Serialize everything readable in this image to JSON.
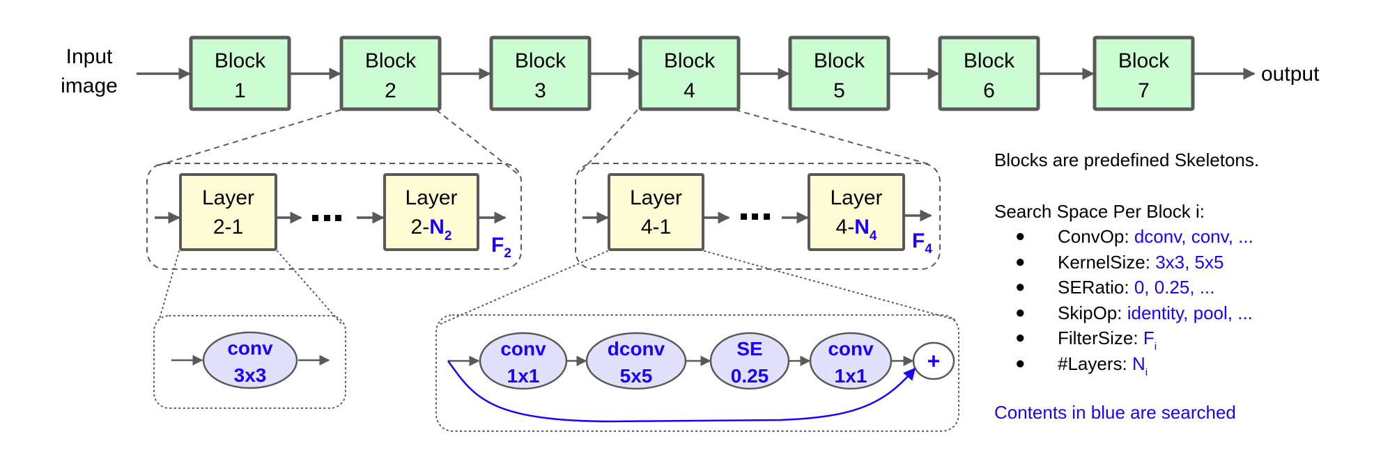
{
  "input_label": [
    "Input",
    "image"
  ],
  "output_label": "output",
  "blocks": [
    {
      "title": "Block",
      "number": "1"
    },
    {
      "title": "Block",
      "number": "2"
    },
    {
      "title": "Block",
      "number": "3"
    },
    {
      "title": "Block",
      "number": "4"
    },
    {
      "title": "Block",
      "number": "5"
    },
    {
      "title": "Block",
      "number": "6"
    },
    {
      "title": "Block",
      "number": "7"
    }
  ],
  "expansions": [
    {
      "block": "2",
      "first_layer": {
        "title": "Layer",
        "id": "2-1"
      },
      "last_layer": {
        "title": "Layer",
        "prefix": "2-",
        "var": "N",
        "sub": "2"
      },
      "ellipsis": "•••",
      "filter": {
        "var": "F",
        "sub": "2"
      }
    },
    {
      "block": "4",
      "first_layer": {
        "title": "Layer",
        "id": "4-1"
      },
      "last_layer": {
        "title": "Layer",
        "prefix": "4-",
        "var": "N",
        "sub": "4"
      },
      "ellipsis": "•••",
      "filter": {
        "var": "F",
        "sub": "4"
      }
    }
  ],
  "layer_2_ops": [
    {
      "op": "conv",
      "param": "3x3"
    }
  ],
  "layer_4_ops": [
    {
      "op": "conv",
      "param": "1x1"
    },
    {
      "op": "dconv",
      "param": "5x5"
    },
    {
      "op": "SE",
      "param": "0.25"
    },
    {
      "op": "conv",
      "param": "1x1"
    }
  ],
  "add_symbol": "+",
  "notes": {
    "intro": "Blocks are predefined Skeletons.",
    "search_space_title": "Search Space Per Block i:",
    "bullet": "●",
    "items": [
      {
        "key": "ConvOp: ",
        "value": "dconv, conv, ..."
      },
      {
        "key": "KernelSize: ",
        "value": "3x3, 5x5"
      },
      {
        "key": "SERatio: ",
        "value": "0, 0.25, ..."
      },
      {
        "key": "SkipOp: ",
        "value": "identity, pool, ..."
      },
      {
        "key": "FilterSize: ",
        "value": "F",
        "sub": "i"
      },
      {
        "key": "#Layers: ",
        "value": "N",
        "sub": "i"
      }
    ],
    "footer": "Contents in blue are searched"
  },
  "colors": {
    "block_fill": "#ccfcd2",
    "layer_fill": "#fdfcd4",
    "op_fill": "#e1e1fb",
    "stroke": "#595959",
    "blue": "#1a00ff"
  }
}
